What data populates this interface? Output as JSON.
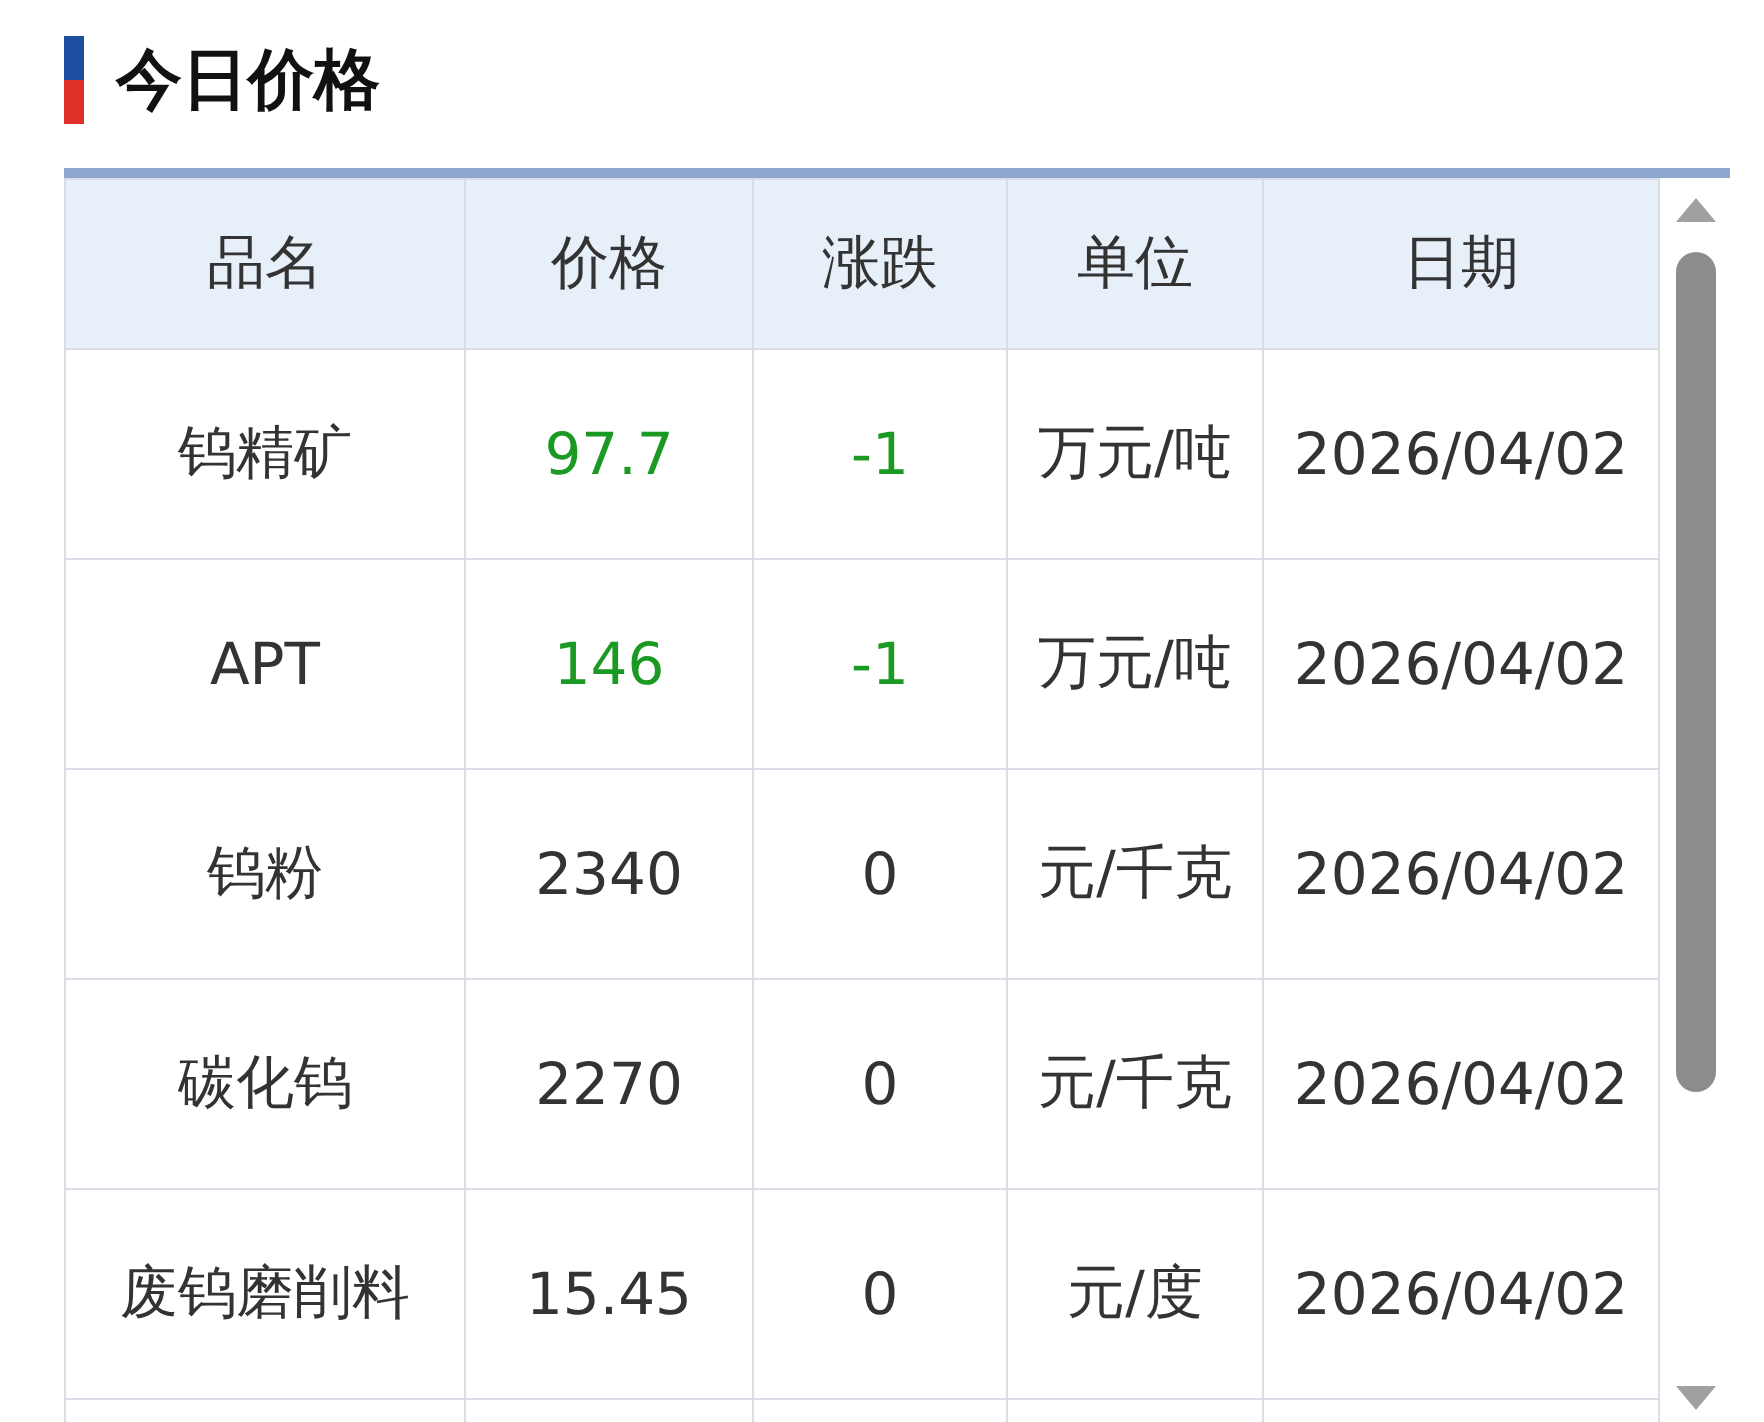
{
  "title": "今日价格",
  "table": {
    "columns": [
      "品名",
      "价格",
      "涨跌",
      "单位",
      "日期"
    ],
    "rows": [
      {
        "name": "钨精矿",
        "price": "97.7",
        "change": "-1",
        "unit": "万元/吨",
        "date": "2026/04/02",
        "color": "#1a9a22"
      },
      {
        "name": "APT",
        "price": "146",
        "change": "-1",
        "unit": "万元/吨",
        "date": "2026/04/02",
        "color": "#1a9a22"
      },
      {
        "name": "钨粉",
        "price": "2340",
        "change": "0",
        "unit": "元/千克",
        "date": "2026/04/02",
        "color": "#333333"
      },
      {
        "name": "碳化钨",
        "price": "2270",
        "change": "0",
        "unit": "元/千克",
        "date": "2026/04/02",
        "color": "#333333"
      },
      {
        "name": "废钨磨削料",
        "price": "15.45",
        "change": "0",
        "unit": "元/度",
        "date": "2026/04/02",
        "color": "#333333"
      }
    ]
  }
}
